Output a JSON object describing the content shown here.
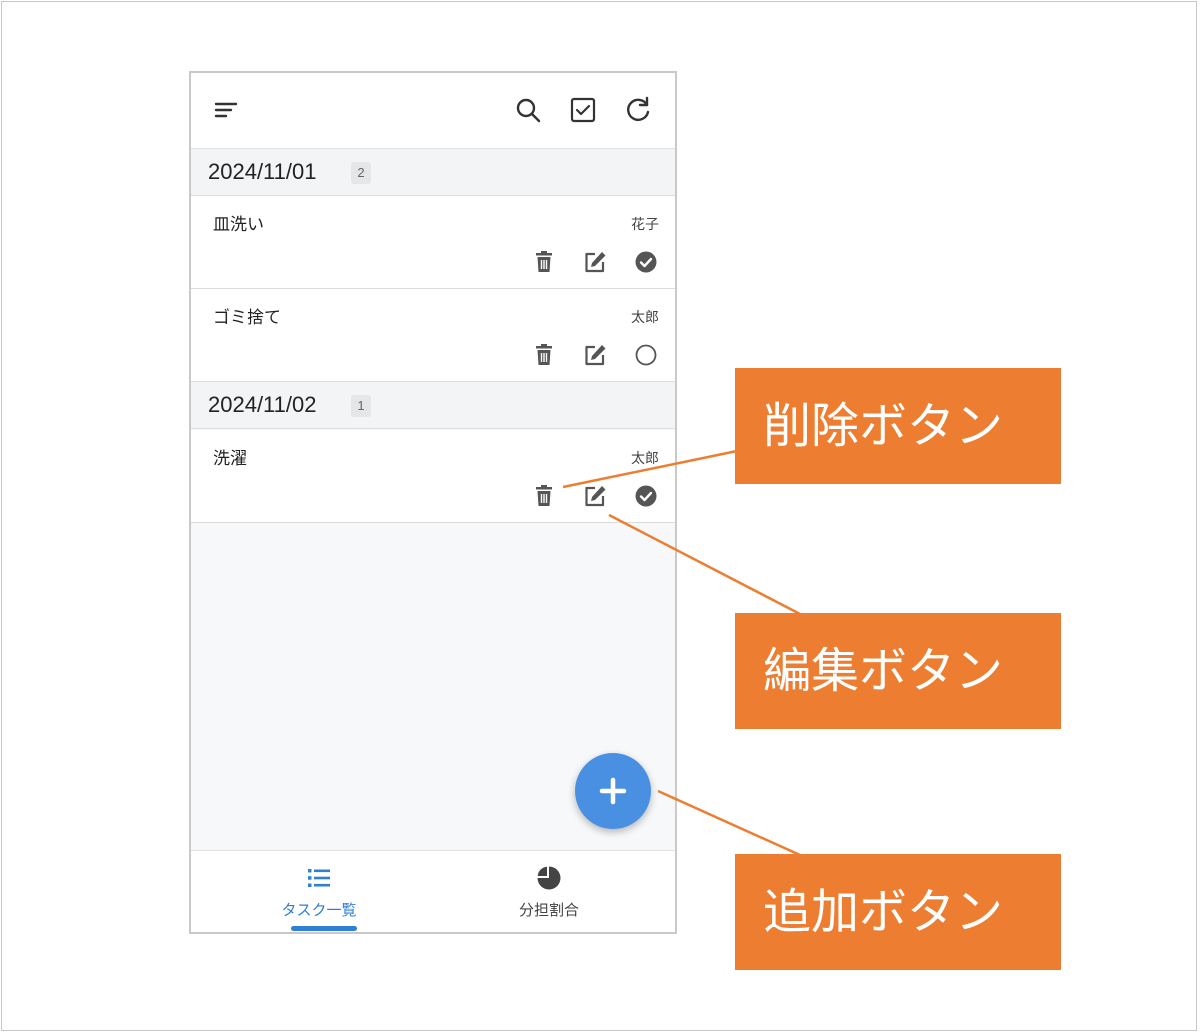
{
  "app": {
    "header_icons": [
      "menu-icon",
      "search-icon",
      "checkbox-icon",
      "refresh-icon"
    ]
  },
  "groups": [
    {
      "date": "2024/11/01",
      "count": "2",
      "tasks": [
        {
          "name": "皿洗い",
          "assignee": "花子",
          "done": true
        },
        {
          "name": "ゴミ捨て",
          "assignee": "太郎",
          "done": false
        }
      ]
    },
    {
      "date": "2024/11/02",
      "count": "1",
      "tasks": [
        {
          "name": "洗濯",
          "assignee": "太郎",
          "done": true
        }
      ]
    }
  ],
  "fab": {
    "icon": "plus-icon"
  },
  "bottom_nav": [
    {
      "label": "タスク一覧",
      "icon": "list-icon",
      "active": true
    },
    {
      "label": "分担割合",
      "icon": "pie-chart-icon",
      "active": false
    }
  ],
  "callouts": {
    "delete": "削除ボタン",
    "edit": "編集ボタン",
    "add": "追加ボタン"
  },
  "colors": {
    "accent_blue": "#4a90e2",
    "callout_orange": "#ed7d31",
    "nav_active": "#2f7fd6",
    "icon_gray": "#555555"
  }
}
